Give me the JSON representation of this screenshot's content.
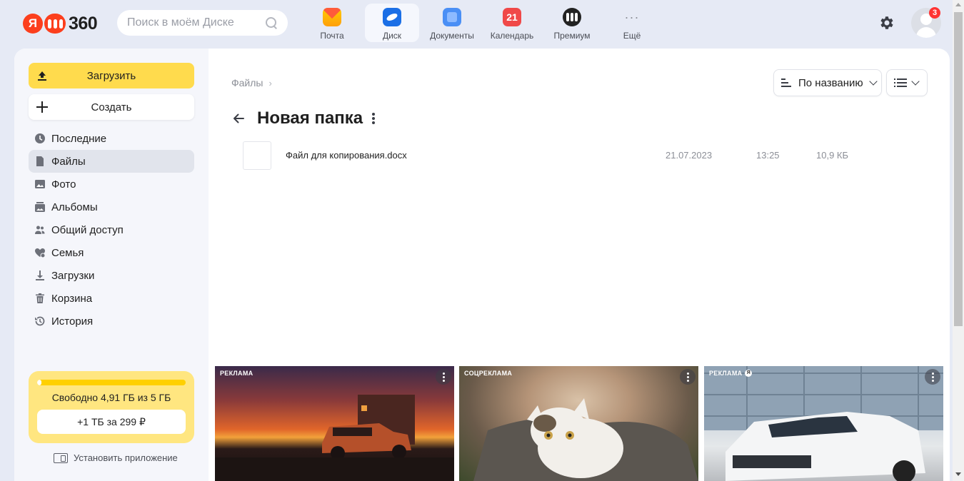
{
  "header": {
    "logo_ya": "Я",
    "logo_text": "360",
    "search_placeholder": "Поиск в моём Диске",
    "services": [
      {
        "label": "Почта",
        "icon": "mail-icon"
      },
      {
        "label": "Диск",
        "icon": "disk-icon",
        "active": true
      },
      {
        "label": "Документы",
        "icon": "documents-icon"
      },
      {
        "label": "Календарь",
        "icon": "calendar-icon",
        "icon_text": "21"
      },
      {
        "label": "Премиум",
        "icon": "premium-icon"
      },
      {
        "label": "Ещё",
        "icon": "more-icon",
        "icon_text": "···"
      }
    ],
    "notification_count": "3"
  },
  "sidebar": {
    "upload_label": "Загрузить",
    "create_label": "Создать",
    "items": [
      {
        "label": "Последние",
        "icon": "clock-icon"
      },
      {
        "label": "Файлы",
        "icon": "file-icon",
        "active": true
      },
      {
        "label": "Фото",
        "icon": "photo-icon"
      },
      {
        "label": "Альбомы",
        "icon": "albums-icon"
      },
      {
        "label": "Общий доступ",
        "icon": "shared-access-icon"
      },
      {
        "label": "Семья",
        "icon": "family-icon"
      },
      {
        "label": "Загрузки",
        "icon": "download-icon"
      },
      {
        "label": "Корзина",
        "icon": "trash-icon"
      },
      {
        "label": "История",
        "icon": "history-icon"
      }
    ],
    "quota": {
      "used_fraction": 0.018,
      "text": "Свободно 4,91 ГБ из 5 ГБ",
      "upgrade_label": "+1 ТБ за 299 ₽"
    },
    "install_label": "Установить приложение"
  },
  "main": {
    "breadcrumb": "Файлы",
    "breadcrumb_sep": "›",
    "folder_title": "Новая папка",
    "sort_label": "По названию",
    "files": [
      {
        "name": "Файл для копирования.docx",
        "date": "21.07.2023",
        "time": "13:25",
        "size": "10,9 КБ"
      }
    ],
    "ads": [
      {
        "label": "РЕКЛАМА"
      },
      {
        "label": "СОЦРЕКЛАМА"
      },
      {
        "label": "РЕКЛАМА",
        "ya_mark": "Я"
      }
    ]
  },
  "colors": {
    "accent_yellow": "#ffdb4d",
    "page_bg": "#e6eaf5",
    "badge_red": "#ff3333"
  }
}
